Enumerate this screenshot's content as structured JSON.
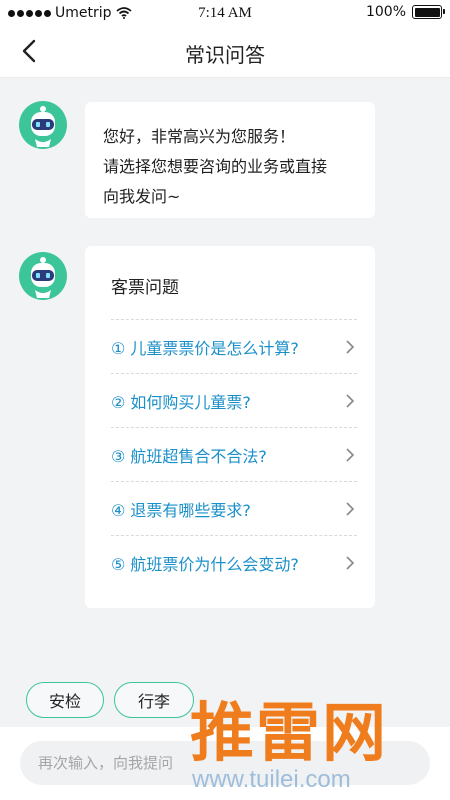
{
  "status_bar": {
    "carrier": "Umetrip",
    "time": "7:14 AM",
    "battery": "100%"
  },
  "header": {
    "title": "常识问答"
  },
  "greeting": {
    "line1": "您好，非常高兴为您服务！",
    "line2": "请选择您想要咨询的业务或直接",
    "line3": "向我发问~"
  },
  "faq": {
    "title": "客票问题",
    "items": [
      {
        "label": "① 儿童票票价是怎么计算?"
      },
      {
        "label": "② 如何购买儿童票?"
      },
      {
        "label": "③ 航班超售合不合法?"
      },
      {
        "label": "④ 退票有哪些要求?"
      },
      {
        "label": "⑤ 航班票价为什么会变动?"
      }
    ]
  },
  "quick_chips": [
    "安检",
    "行李"
  ],
  "input": {
    "placeholder": "再次输入，向我提问"
  },
  "watermark": {
    "brand": "推雷网",
    "url": "www.tuilei.com"
  },
  "colors": {
    "accent": "#3dc59a",
    "link": "#1a8fc9",
    "watermark": "#f07d1d"
  }
}
